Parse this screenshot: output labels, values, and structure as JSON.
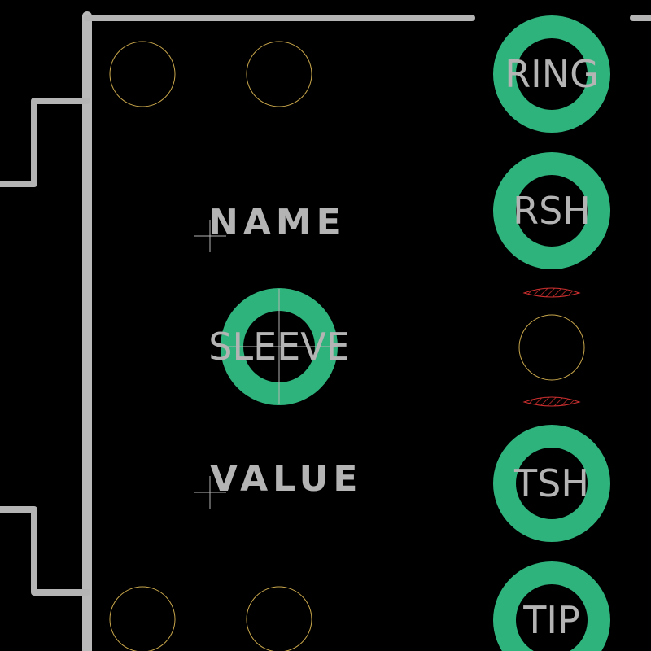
{
  "colors": {
    "background": "#000000",
    "silkscreen": "#b4b4b4",
    "copper_pad": "#2fb37c",
    "drill_outline": "#c8a64b",
    "keepout": "#d03030"
  },
  "labels": {
    "name": "NAME",
    "value": "VALUE"
  },
  "pads": {
    "ring": "RING",
    "rsh": "RSH",
    "sleeve": "SLEEVE",
    "tsh": "TSH",
    "tip": "TIP"
  }
}
